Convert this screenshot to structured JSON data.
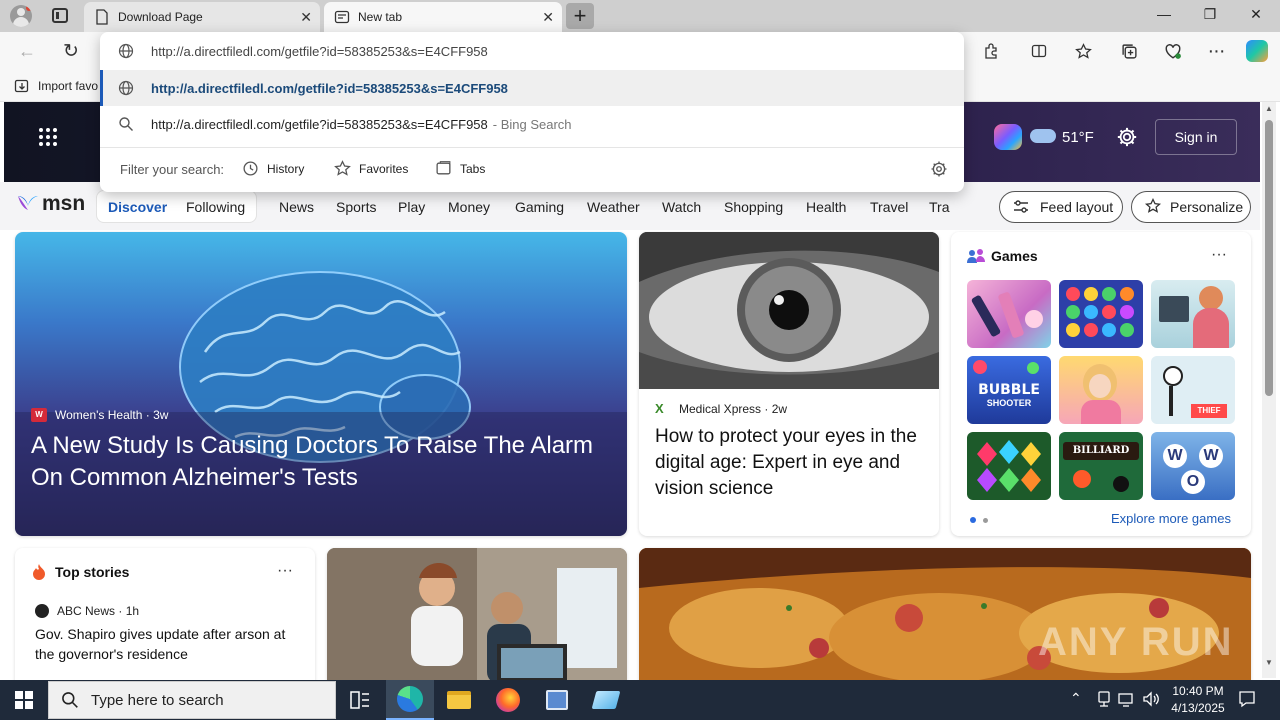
{
  "tabs": [
    {
      "title": "Download Page"
    },
    {
      "title": "New tab"
    }
  ],
  "window_controls": {
    "minimize": "—",
    "restore": "❐",
    "close": "✕"
  },
  "toolbar": {
    "back": "←",
    "reload": "↻"
  },
  "favorites_bar": {
    "import": "Import favo"
  },
  "omnibox": {
    "value": "http://a.directfiledl.com/getfile?id=58385253&s=E4CFF958",
    "suggestion_url": "http://a.directfiledl.com/getfile?id=58385253&s=E4CFF958",
    "search_text": "http://a.directfiledl.com/getfile?id=58385253&s=E4CFF958",
    "search_suffix": "- Bing Search",
    "filter_label": "Filter your search:",
    "filters": [
      "History",
      "Favorites",
      "Tabs"
    ]
  },
  "msn_header": {
    "weather": "51°F",
    "sign_in": "Sign in"
  },
  "msn_nav": {
    "logo": "msn",
    "tabs": [
      "Discover",
      "Following"
    ],
    "items": [
      "News",
      "Sports",
      "Play",
      "Money",
      "Gaming",
      "Weather",
      "Watch",
      "Shopping",
      "Health",
      "Travel",
      "Tra"
    ],
    "feed_layout": "Feed layout",
    "personalize": "Personalize"
  },
  "hero": {
    "source": "Women's Health",
    "age": "3w",
    "headline": "A New Study Is Causing Doctors To Raise The Alarm On Common Alzheimer's Tests"
  },
  "eye_card": {
    "source": "Medical Xpress",
    "age": "2w",
    "headline": "How to protect your eyes in the digital age: Expert in eye and vision science"
  },
  "games": {
    "title": "Games",
    "more": "···",
    "explore": "Explore more games",
    "tiles": [
      "Makeup",
      "Jewels",
      "Hospital",
      "BUBBLE SHOOTER",
      "Dress Up",
      "Thief Puzzle",
      "Gems",
      "8 Ball BILLIARD",
      "WOW"
    ]
  },
  "top_stories": {
    "title": "Top stories",
    "more": "···",
    "source": "ABC News",
    "age": "1h",
    "headline": "Gov. Shapiro gives update after arson at the governor's residence"
  },
  "watermark": "ANY RUN",
  "taskbar": {
    "search_placeholder": "Type here to search",
    "time": "10:40 PM",
    "date": "4/13/2025"
  }
}
